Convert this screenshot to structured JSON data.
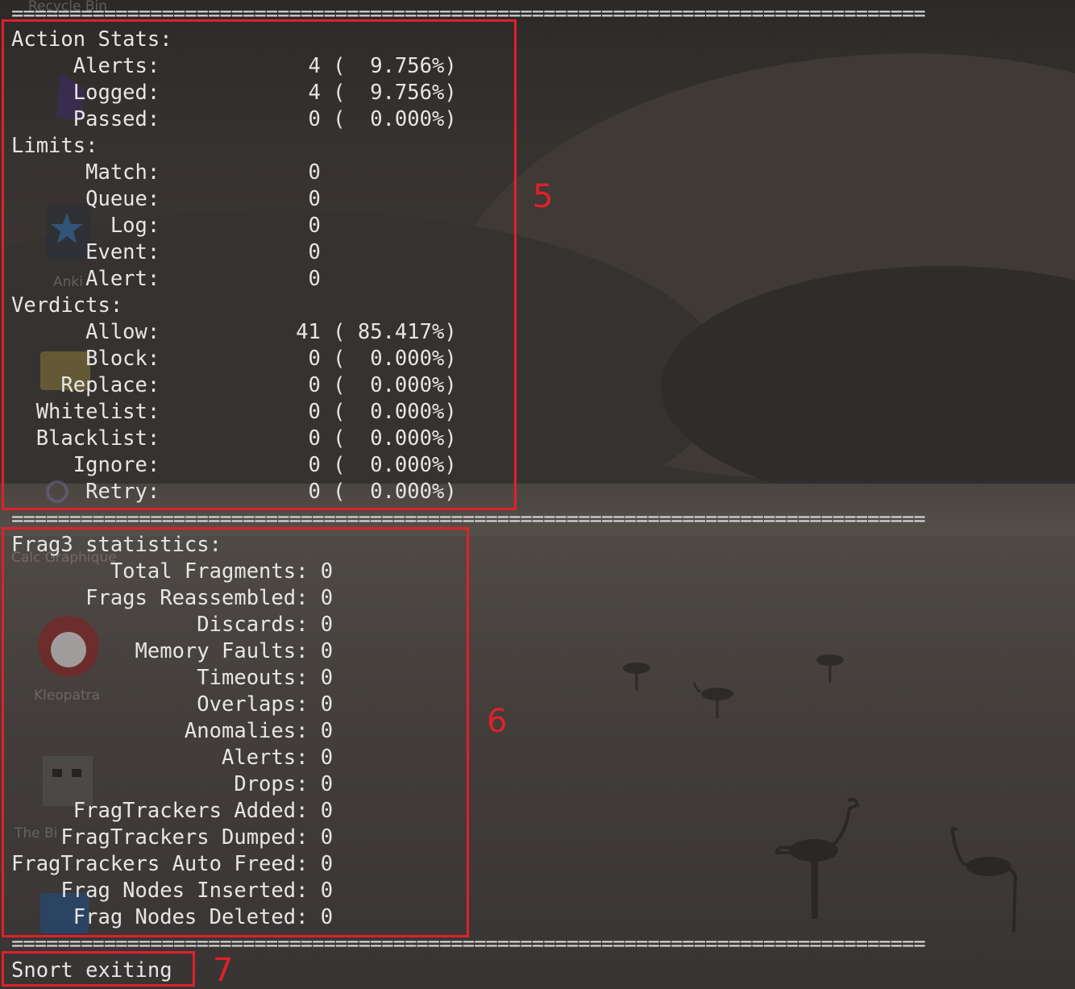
{
  "separator": "===============================================================================",
  "desktop_icons": [
    {
      "label": "Recycle Bin"
    },
    {
      "label": "Anki"
    },
    {
      "label": "Calc Graphique"
    },
    {
      "label": "Kleopatra"
    },
    {
      "label": "The Bi"
    }
  ],
  "action_stats": {
    "title": "Action Stats:",
    "rows": [
      "     Alerts:            4 (  9.756%)",
      "     Logged:            4 (  9.756%)",
      "     Passed:            0 (  0.000%)"
    ]
  },
  "limits": {
    "title": "Limits:",
    "rows": [
      "      Match:            0",
      "      Queue:            0",
      "        Log:            0",
      "      Event:            0",
      "      Alert:            0"
    ]
  },
  "verdicts": {
    "title": "Verdicts:",
    "rows": [
      "      Allow:           41 ( 85.417%)",
      "      Block:            0 (  0.000%)",
      "    Replace:            0 (  0.000%)",
      "  Whitelist:            0 (  0.000%)",
      "  Blacklist:            0 (  0.000%)",
      "     Ignore:            0 (  0.000%)",
      "      Retry:            0 (  0.000%)"
    ]
  },
  "frag3": {
    "title": "Frag3 statistics:",
    "rows": [
      "        Total Fragments: 0",
      "      Frags Reassembled: 0",
      "               Discards: 0",
      "          Memory Faults: 0",
      "               Timeouts: 0",
      "               Overlaps: 0",
      "              Anomalies: 0",
      "                 Alerts: 0",
      "                  Drops: 0",
      "     FragTrackers Added: 0",
      "    FragTrackers Dumped: 0",
      "FragTrackers Auto Freed: 0",
      "    Frag Nodes Inserted: 0",
      "     Frag Nodes Deleted: 0"
    ]
  },
  "exit_line": "Snort exiting",
  "annotations": {
    "box5": "5",
    "box6": "6",
    "box7": "7",
    "color": "#e0202a"
  }
}
